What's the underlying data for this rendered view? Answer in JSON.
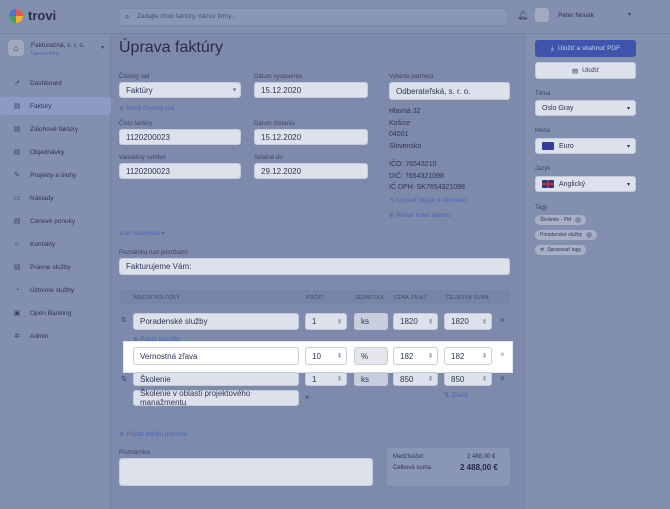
{
  "brand": {
    "name": "trovi"
  },
  "search": {
    "placeholder": "Zadajte číslo faktúry, názov firmy..."
  },
  "user": {
    "name": "Peter Novák"
  },
  "company": {
    "name": "Fakturačná, s. r. o.",
    "sub": "Úprava firmy"
  },
  "nav": [
    {
      "label": "Dashboard",
      "icon": "chart-line-icon",
      "glyph": "↗"
    },
    {
      "label": "Faktúry",
      "icon": "invoice-icon",
      "glyph": "▤",
      "active": true
    },
    {
      "label": "Zálohové faktúry",
      "icon": "deposit-invoice-icon",
      "glyph": "▤"
    },
    {
      "label": "Objednávky",
      "icon": "order-icon",
      "glyph": "▤"
    },
    {
      "label": "Projekty a úlohy",
      "icon": "project-icon",
      "glyph": "✎"
    },
    {
      "label": "Náklady",
      "icon": "cost-icon",
      "glyph": "▭"
    },
    {
      "label": "Cenové ponuky",
      "icon": "quote-icon",
      "glyph": "▤"
    },
    {
      "label": "Kontakty",
      "icon": "contacts-icon",
      "glyph": "☺"
    },
    {
      "label": "Právne služby",
      "icon": "legal-icon",
      "glyph": "▤"
    },
    {
      "label": "Účtovné služby",
      "icon": "accounting-icon",
      "glyph": "◔"
    },
    {
      "label": "Open Banking",
      "icon": "bank-icon",
      "glyph": "▣"
    },
    {
      "label": "Admin",
      "icon": "gear-icon",
      "glyph": "✲"
    }
  ],
  "page": {
    "title": "Úprava faktúry"
  },
  "form": {
    "series_label": "Číselný rad",
    "series_value": "Faktúry",
    "new_series": "Nový číselný rad",
    "invoice_no_label": "Číslo faktúry",
    "invoice_no": "1120200023",
    "var_symbol_label": "Variabilný symbol",
    "var_symbol": "1120200023",
    "issue_label": "Dátum vystavenia",
    "issue": "15.12.2020",
    "delivery_label": "Dátum dodania",
    "delivery": "15.12.2020",
    "due_label": "Splatné do",
    "due": "29.12.2020",
    "partner_label": "Vyberte partnera",
    "partner": "Odberateľská, s. r. o.",
    "address": [
      "Hlavná 32",
      "Košice",
      "04001",
      "Slovensko"
    ],
    "ids": [
      "IČO: 76543210",
      "DIČ: 7654321098",
      "IČ DPH: SK7654321098"
    ],
    "edit_client": "Upraviť údaje o klientovi",
    "add_branch": "Pridať novú klientu",
    "more_options": "Viac možností",
    "note_above_label": "Poznámka nad položkami",
    "note_above": "Fakturujeme Vám:"
  },
  "table": {
    "headers": [
      "NÁZOV POLOŽKY",
      "POČET",
      "JEDNOTKA",
      "CENA ZA MJ",
      "CELKOVÁ SUMA"
    ],
    "rows": [
      {
        "name": "Poradenské služby",
        "qty": "1",
        "unit": "ks",
        "price": "1820",
        "total": "1820"
      },
      {
        "name": "Vernostná zľava",
        "qty": "10",
        "unit": "%",
        "price": "182",
        "total": "182"
      },
      {
        "name": "Školenie",
        "qty": "1",
        "unit": "ks",
        "price": "850",
        "total": "850"
      }
    ],
    "add_desc": "Popis položky",
    "desc_value": "Školenie v oblasti projektového manažmentu",
    "less": "Zľava",
    "add_item": "Pridať ďalšiu položku"
  },
  "notes": {
    "label": "Poznámka"
  },
  "totals": {
    "subtotal_label": "Medzisúčet",
    "subtotal": "2 488,00 €",
    "total_label": "Celková suma",
    "total": "2 488,00 €"
  },
  "right": {
    "save_pdf": "Uložiť a stiahnuť PDF",
    "save": "Uložiť",
    "theme_label": "Téma",
    "theme": "Oslo Gray",
    "currency_label": "Mena",
    "currency": "Euro",
    "language_label": "Jazyk",
    "language": "Anglický",
    "tags_label": "Tagy",
    "tags": [
      "Školenie - PM",
      "Poradenské služby",
      "Spravovať tagy"
    ]
  },
  "colors": {
    "accent": "#3b5bd6",
    "overlay": "#7e8aab",
    "highlight": "#ffffff"
  }
}
